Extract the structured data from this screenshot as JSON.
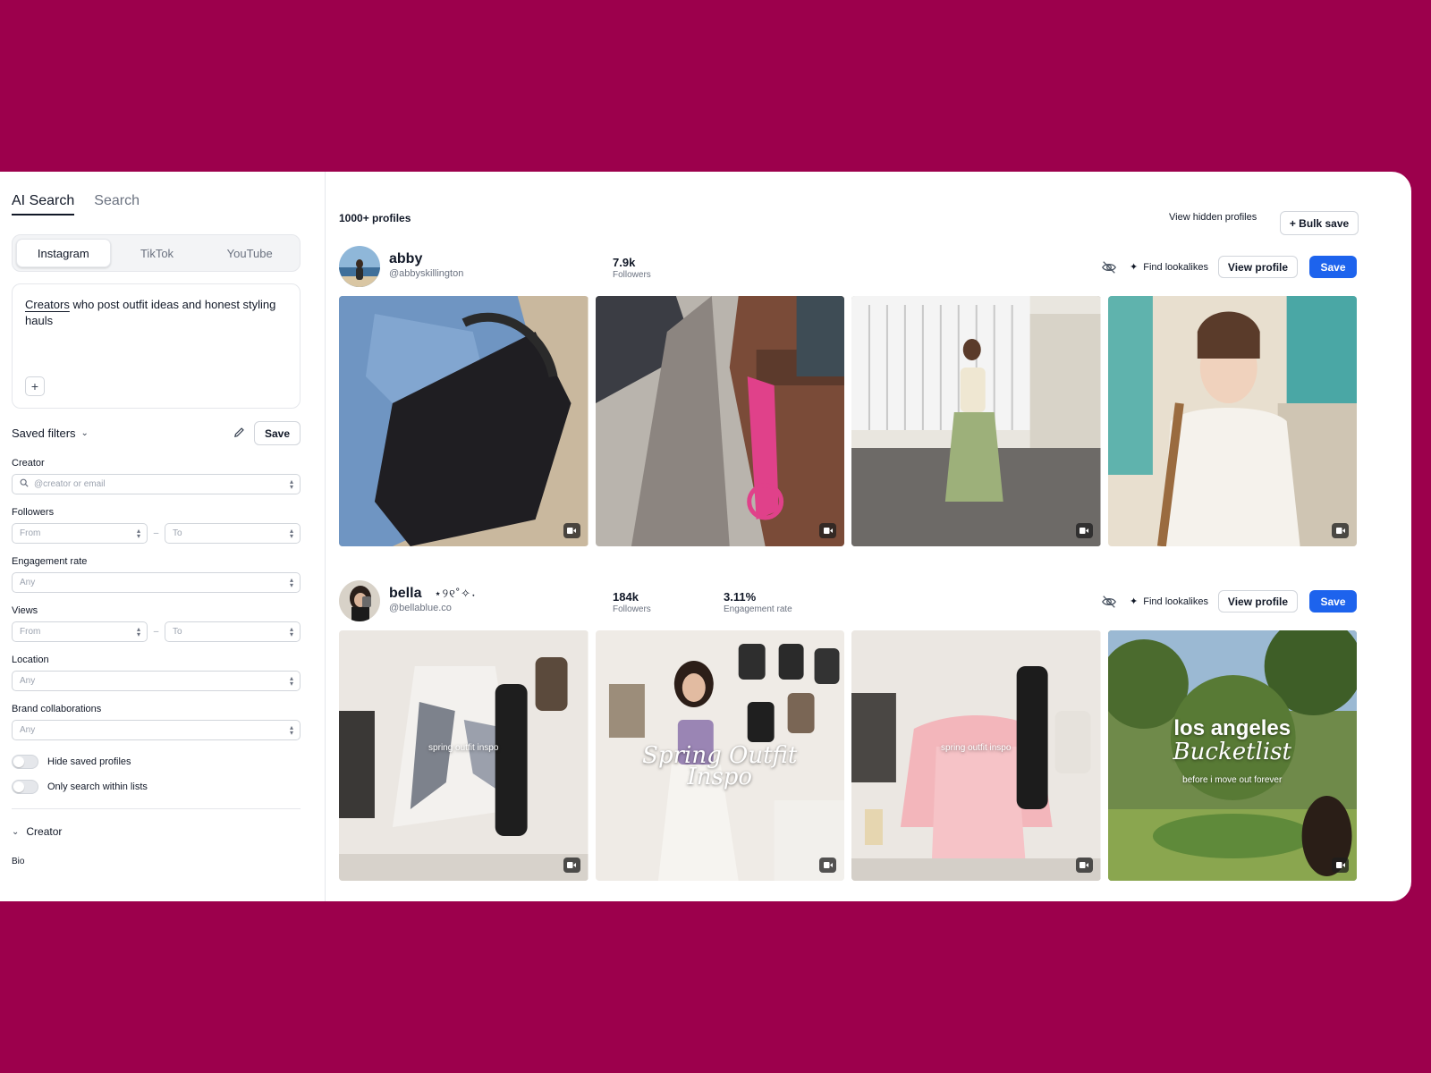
{
  "sidebar": {
    "tabs": [
      {
        "label": "AI Search"
      },
      {
        "label": "Search"
      }
    ],
    "platforms": [
      {
        "label": "Instagram"
      },
      {
        "label": "TikTok"
      },
      {
        "label": "YouTube"
      }
    ],
    "query": {
      "highlight": "Creators",
      "rest": " who post outfit ideas and honest styling hauls"
    },
    "saved_filters_label": "Saved filters",
    "save_label": "Save",
    "filters": {
      "creator": {
        "label": "Creator",
        "placeholder": "@creator or email"
      },
      "followers": {
        "label": "Followers",
        "from": "From",
        "to": "To"
      },
      "engagement": {
        "label": "Engagement rate",
        "value": "Any"
      },
      "views": {
        "label": "Views",
        "from": "From",
        "to": "To"
      },
      "location": {
        "label": "Location",
        "value": "Any"
      },
      "brand": {
        "label": "Brand collaborations",
        "value": "Any"
      }
    },
    "toggles": [
      {
        "label": "Hide saved profiles"
      },
      {
        "label": "Only search within lists"
      }
    ],
    "section": {
      "label": "Creator"
    },
    "bio_label": "Bio"
  },
  "main": {
    "count_label": "1000+ profiles",
    "view_hidden": "View hidden profiles",
    "bulk_save": "+ Bulk save",
    "find_lookalikes": "Find lookalikes",
    "view_profile": "View profile",
    "save": "Save",
    "profiles": [
      {
        "name": "abby",
        "handle": "@abbyskillington",
        "followers": "7.9k",
        "followers_label": "Followers"
      },
      {
        "name": "bella",
        "name_deco": "⋆୨୧˚✧˖",
        "handle": "@bellablue.co",
        "followers": "184k",
        "followers_label": "Followers",
        "engagement": "3.11%",
        "engagement_label": "Engagement rate",
        "overlays": {
          "t1": "spring outfit inspo",
          "t2a": "Spring Outfit",
          "t2b": "Inspo",
          "t3": "spring outfit inspo",
          "t4a": "los angeles",
          "t4b": "Bucketlist",
          "t4c": "before i move out forever"
        }
      }
    ]
  },
  "colors": {
    "background": "#9c004c",
    "accent": "#1d63ed"
  },
  "icons": {
    "search": "search-icon",
    "pencil": "pencil-icon",
    "hide": "eye-off-icon",
    "sparkle": "sparkle-icon",
    "video": "video-icon"
  }
}
